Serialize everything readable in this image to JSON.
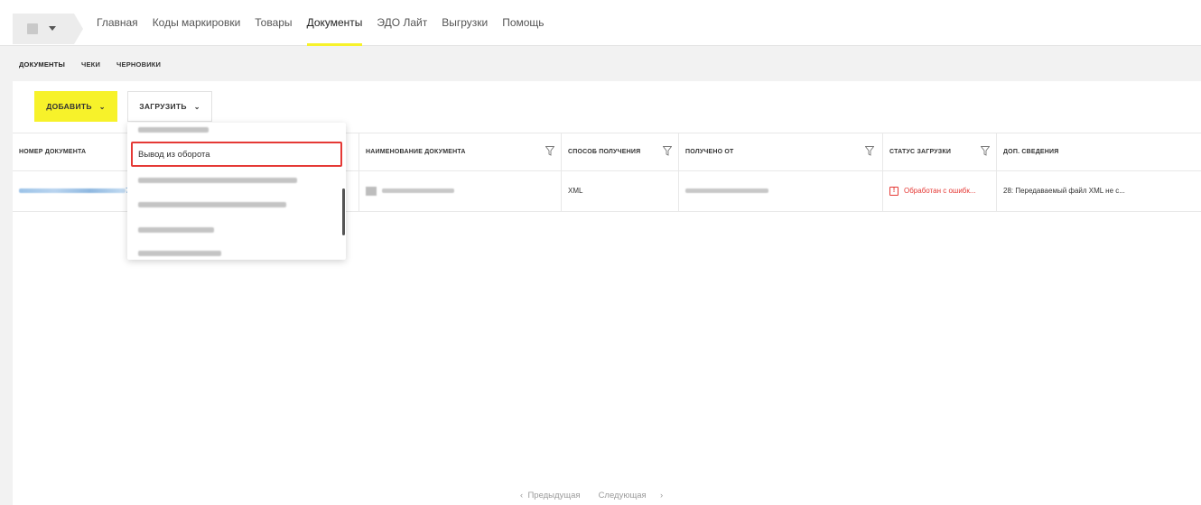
{
  "nav": {
    "items": [
      "Главная",
      "Коды маркировки",
      "Товары",
      "Документы",
      "ЭДО Лайт",
      "Выгрузки",
      "Помощь"
    ],
    "active_index": 3
  },
  "subtabs": {
    "items": [
      "ДОКУМЕНТЫ",
      "ЧЕКИ",
      "ЧЕРНОВИКИ"
    ],
    "active_index": 0
  },
  "toolbar": {
    "add_label": "ДОБАВИТЬ",
    "load_label": "ЗАГРУЗИТЬ"
  },
  "table": {
    "columns": [
      "НОМЕР ДОКУМЕНТА",
      "НАИМЕНОВАНИЕ ДОКУМЕНТА",
      "СПОСОБ ПОЛУЧЕНИЯ",
      "ПОЛУЧЕНО ОТ",
      "СТАТУС ЗАГРУЗКИ",
      "ДОП. СВЕДЕНИЯ"
    ],
    "rows": [
      {
        "number_tail": "7",
        "method": "XML",
        "status": "Обработан с ошибк...",
        "info": "28: Передаваемый файл XML не с..."
      }
    ]
  },
  "dropdown": {
    "highlighted_item": "Вывод из оборота"
  },
  "pager": {
    "prev": "Предыдущая",
    "next": "Следующая"
  },
  "colors": {
    "accent": "#f7f22a",
    "error": "#e53935",
    "link": "#9cc3e8"
  }
}
